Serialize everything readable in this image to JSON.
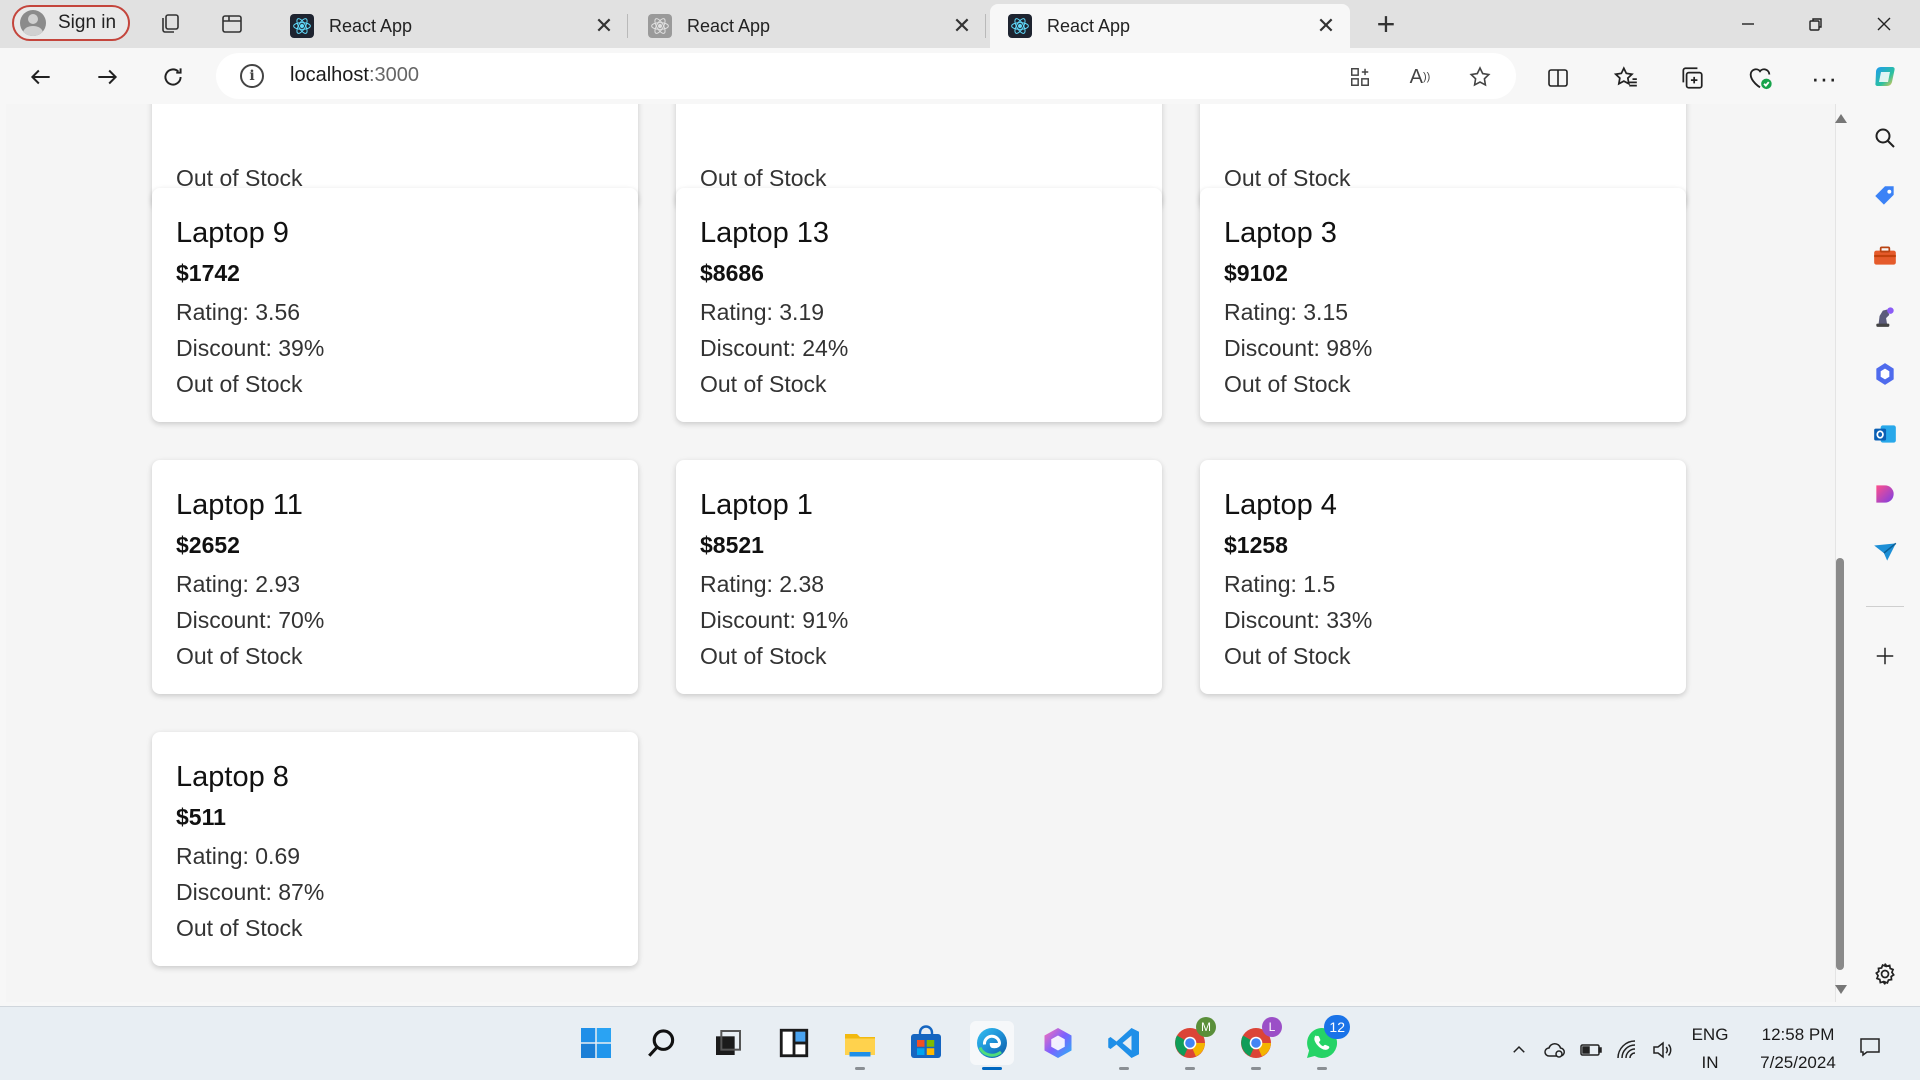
{
  "browser": {
    "signin_label": "Sign in",
    "tabs": [
      {
        "title": "React App"
      },
      {
        "title": "React App"
      },
      {
        "title": "React App"
      }
    ],
    "url_host": "localhost",
    "url_port": ":3000"
  },
  "partial_cards": [
    {
      "stock": "Out of Stock"
    },
    {
      "stock": "Out of Stock"
    },
    {
      "stock": "Out of Stock"
    }
  ],
  "products": [
    {
      "name": "Laptop 9",
      "price": "$1742",
      "rating": "Rating: 3.56",
      "discount": "Discount: 39%",
      "stock": "Out of Stock"
    },
    {
      "name": "Laptop 13",
      "price": "$8686",
      "rating": "Rating: 3.19",
      "discount": "Discount: 24%",
      "stock": "Out of Stock"
    },
    {
      "name": "Laptop 3",
      "price": "$9102",
      "rating": "Rating: 3.15",
      "discount": "Discount: 98%",
      "stock": "Out of Stock"
    },
    {
      "name": "Laptop 11",
      "price": "$2652",
      "rating": "Rating: 2.93",
      "discount": "Discount: 70%",
      "stock": "Out of Stock"
    },
    {
      "name": "Laptop 1",
      "price": "$8521",
      "rating": "Rating: 2.38",
      "discount": "Discount: 91%",
      "stock": "Out of Stock"
    },
    {
      "name": "Laptop 4",
      "price": "$1258",
      "rating": "Rating: 1.5",
      "discount": "Discount: 33%",
      "stock": "Out of Stock"
    },
    {
      "name": "Laptop 8",
      "price": "$511",
      "rating": "Rating: 0.69",
      "discount": "Discount: 87%",
      "stock": "Out of Stock"
    }
  ],
  "taskbar": {
    "whatsapp_badge": "12",
    "chrome_profile_1": "M",
    "chrome_profile_2": "L",
    "lang_top": "ENG",
    "lang_bottom": "IN",
    "time": "12:58 PM",
    "date": "7/25/2024"
  },
  "colors": {
    "signin_border": "#c4453c",
    "edge_accent": "#0067c0",
    "badge": "#1a73e8"
  }
}
